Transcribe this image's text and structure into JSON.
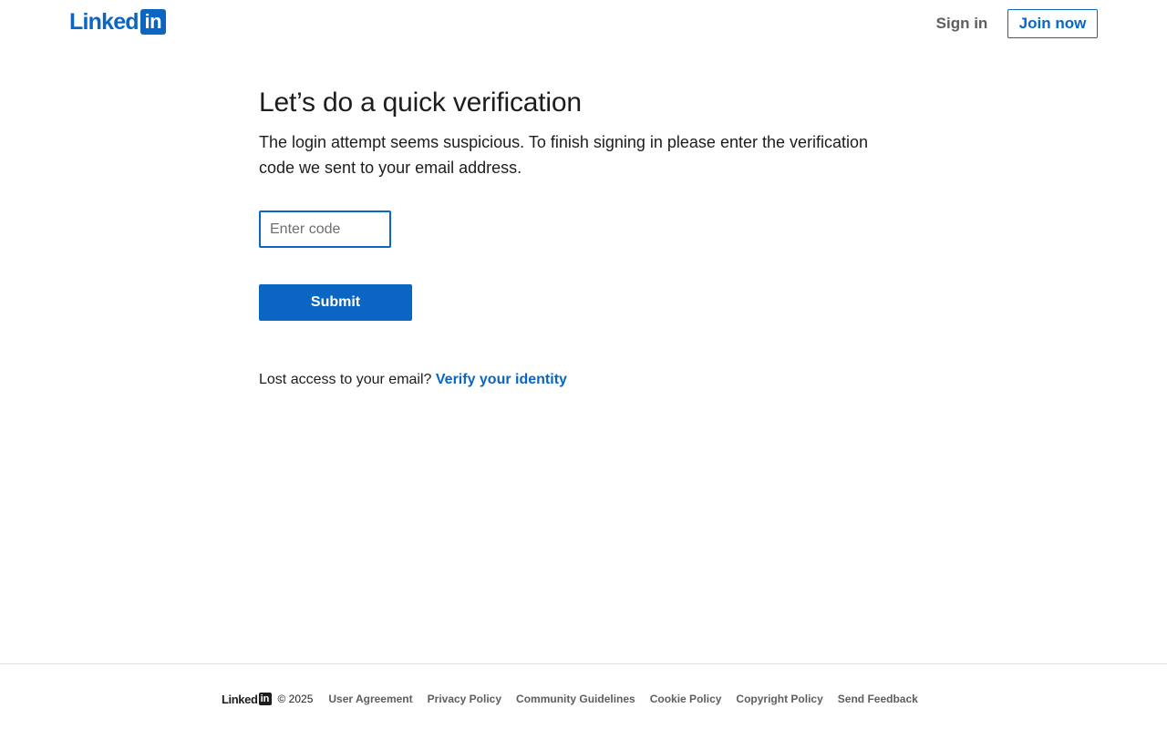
{
  "header": {
    "logo_word": "Linked",
    "logo_box": "in",
    "sign_in": "Sign in",
    "join_now": "Join now"
  },
  "main": {
    "title": "Let’s do a quick verification",
    "description": "The login attempt seems suspicious. To finish signing in please enter the verification code we sent to your email address.",
    "code_placeholder": "Enter code",
    "submit": "Submit",
    "lost_access_text": "Lost access to your email?",
    "verify_link": "Verify your identity"
  },
  "footer": {
    "logo_word": "Linked",
    "logo_box": "in",
    "copyright": "© 2025",
    "links": [
      "User Agreement",
      "Privacy Policy",
      "Community Guidelines",
      "Cookie Policy",
      "Copyright Policy",
      "Send Feedback"
    ]
  },
  "colors": {
    "brand": "#0a66c2",
    "text": "#1d1d1d",
    "muted": "#5e5e5e"
  }
}
